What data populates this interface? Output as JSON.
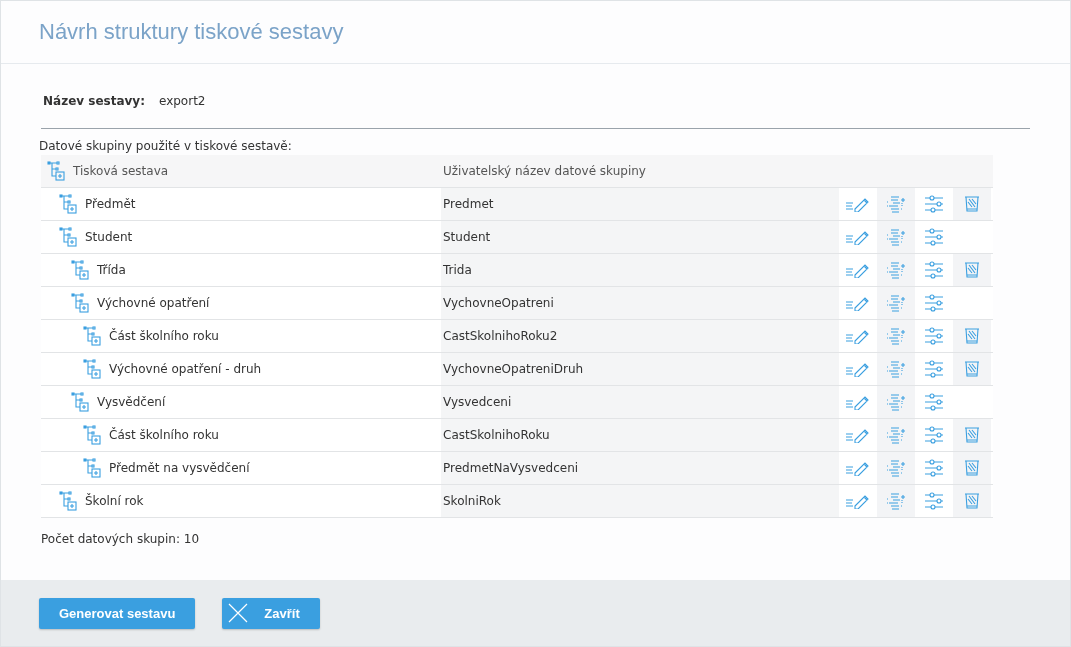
{
  "dialog": {
    "title": "Návrh struktury tiskové sestavy"
  },
  "report_name": {
    "label": "Název sestavy:",
    "value": "export2"
  },
  "groups_caption": "Datové skupiny použité v tiskové sestavě:",
  "tree": {
    "columns": [
      "Tisková sestava",
      "Uživatelský název datové skupiny"
    ],
    "rows": [
      {
        "name": "Předmět",
        "user_name": "Predmet",
        "can_delete": true
      },
      {
        "name": "Student",
        "user_name": "Student",
        "can_delete": false,
        "children": [
          {
            "name": "Třída",
            "user_name": "Trida",
            "can_delete": true
          },
          {
            "name": "Výchovné opatření",
            "user_name": "VychovneOpatreni",
            "can_delete": false,
            "children": [
              {
                "name": "Část školního roku",
                "user_name": "CastSkolnihoRoku2",
                "can_delete": true
              },
              {
                "name": "Výchovné opatření - druh",
                "user_name": "VychovneOpatreniDruh",
                "can_delete": true
              }
            ]
          },
          {
            "name": "Vysvědčení",
            "user_name": "Vysvedceni",
            "can_delete": false,
            "children": [
              {
                "name": "Část školního roku",
                "user_name": "CastSkolnihoRoku",
                "can_delete": true
              },
              {
                "name": "Předmět na vysvědčení",
                "user_name": "PredmetNaVysvedceni",
                "can_delete": true
              }
            ]
          }
        ]
      },
      {
        "name": "Školní rok",
        "user_name": "SkolniRok",
        "can_delete": true
      }
    ]
  },
  "count": "Počet datových skupin: 10",
  "buttons": [
    {
      "kind": "primary",
      "label": "Generovat sestavu"
    },
    {
      "kind": "close",
      "label": "Zavřít"
    }
  ]
}
